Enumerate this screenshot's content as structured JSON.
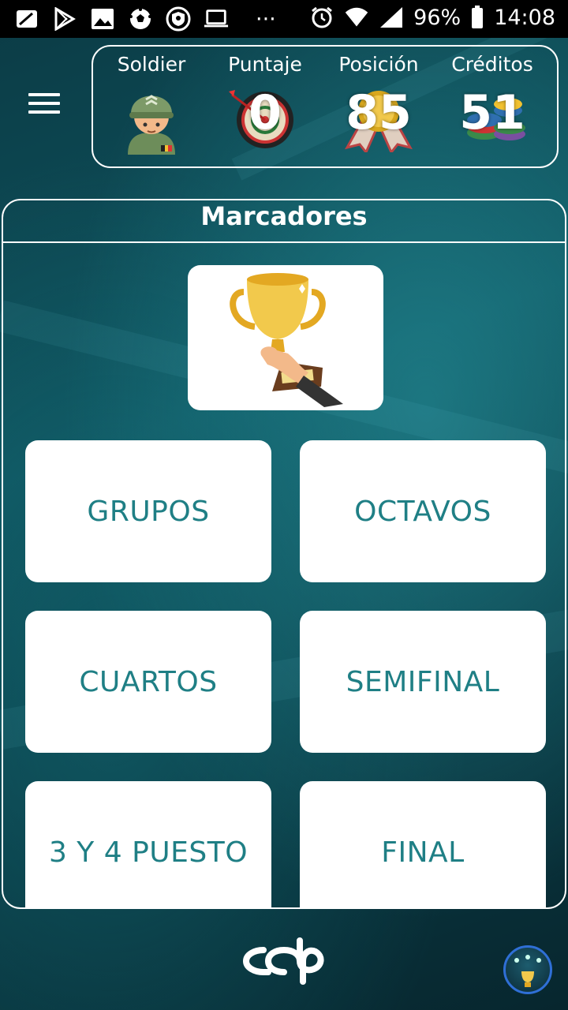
{
  "status_bar": {
    "battery": "96%",
    "time": "14:08",
    "dots": "···"
  },
  "header": {
    "menu_icon": "hamburger-menu-icon",
    "stats": [
      {
        "label": "Soldier",
        "icon": "soldier-avatar-icon"
      },
      {
        "label": "Puntaje",
        "value": "0",
        "icon": "dartboard-icon"
      },
      {
        "label": "Posición",
        "value": "85",
        "icon": "ribbon-medal-icon"
      },
      {
        "label": "Créditos",
        "value": "51",
        "icon": "poker-chips-icon"
      }
    ]
  },
  "panel": {
    "title": "Marcadores",
    "trophy_icon": "trophy-icon",
    "buttons": [
      "GRUPOS",
      "OCTAVOS",
      "CUARTOS",
      "SEMIFINAL",
      "3 Y 4 PUESTO",
      "FINAL"
    ]
  },
  "colors": {
    "accent": "#1f7f85",
    "background": "#0f5560",
    "avatar_border": "#2f6fd6"
  }
}
